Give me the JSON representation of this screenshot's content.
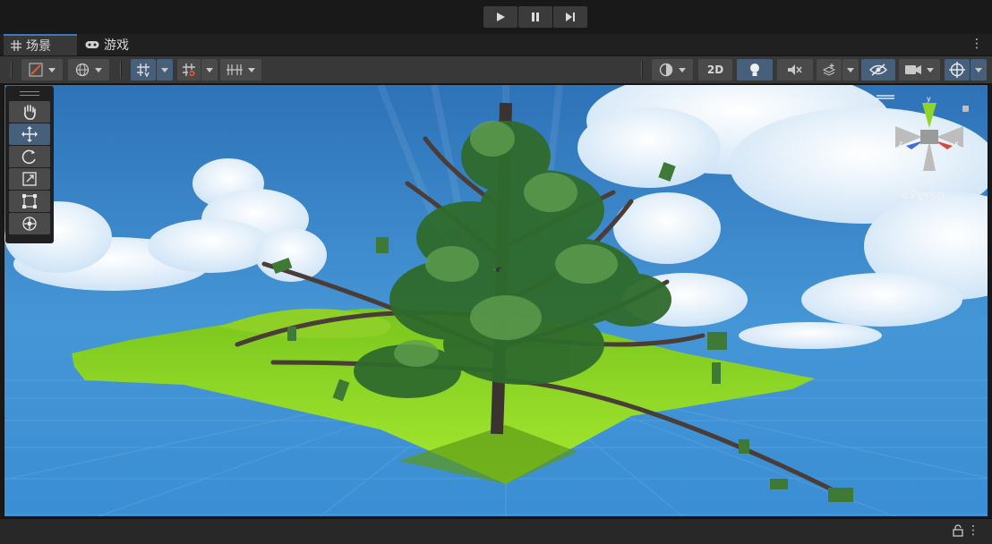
{
  "play_controls": {
    "play": "play-icon",
    "pause": "pause-icon",
    "step": "step-icon"
  },
  "tabs": [
    {
      "label": "场景",
      "icon": "grid-icon",
      "active": true
    },
    {
      "label": "游戏",
      "icon": "gamepad-icon",
      "active": false
    }
  ],
  "toolbar": {
    "left": [
      "draw-mode-icon",
      "global-icon",
      "snap-grid-icon",
      "increment-snap-icon",
      "grid-visibility-icon"
    ],
    "right": [
      "shading-mode-icon",
      "lighting-icon",
      "audio-icon",
      "effects-icon",
      "scene-visibility-icon",
      "camera-icon",
      "gizmos-icon"
    ],
    "label_2d": "2D"
  },
  "tools": [
    "hand-icon",
    "move-icon",
    "rotate-icon",
    "scale-icon",
    "rect-icon",
    "transform-icon"
  ],
  "selected_tool": "move",
  "gizmo": {
    "projection_label": "Persp",
    "axes": [
      "y",
      "x",
      "z"
    ]
  },
  "colors": {
    "accent": "#3a79bb",
    "selected": "#46607c",
    "sky": "#3f8fd6",
    "grass": "#9be02a",
    "gizmo_y": "#8fd42b",
    "gizmo_x": "#d64a3d",
    "gizmo_z": "#3d6fd6"
  }
}
